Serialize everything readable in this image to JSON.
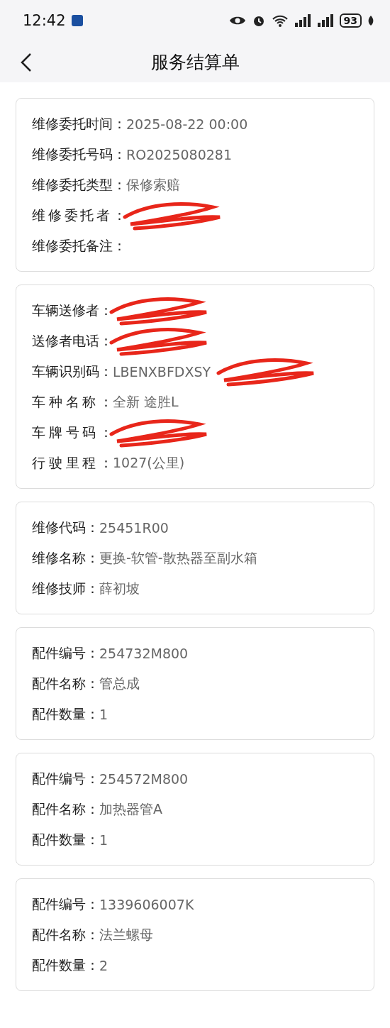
{
  "status_bar": {
    "time": "12:42",
    "battery": "93"
  },
  "header": {
    "title": "服务结算单"
  },
  "cards": [
    {
      "rows": [
        {
          "label": "维修委托时间：",
          "value": "2025-08-22 00:00"
        },
        {
          "label": "维修委托号码：",
          "value": "RO2025080281"
        },
        {
          "label": "维修委托类型：",
          "value": "保修索赔"
        },
        {
          "label": "维修委托者：",
          "redacted": true
        },
        {
          "label": "维修委托备注："
        }
      ]
    },
    {
      "rows": [
        {
          "label": "车辆送修者：",
          "redacted": true
        },
        {
          "label": "送修者电话：",
          "redacted": true
        },
        {
          "label": "车辆识别码：",
          "value": "LBENXBFDXSY",
          "redacted": true
        },
        {
          "label": "车种名称：",
          "value": "全新 途胜L"
        },
        {
          "label": "车牌号码：",
          "redacted": true
        },
        {
          "label": "行驶里程：",
          "value": "1027(公里)"
        }
      ]
    },
    {
      "rows": [
        {
          "label": "维修代码：",
          "value": "25451R00"
        },
        {
          "label": "维修名称：",
          "value": "更换-软管-散热器至副水箱"
        },
        {
          "label": "维修技师：",
          "value": "薛初坡"
        }
      ]
    },
    {
      "rows": [
        {
          "label": "配件编号：",
          "value": "254732M800"
        },
        {
          "label": "配件名称：",
          "value": "管总成"
        },
        {
          "label": "配件数量：",
          "value": "1"
        }
      ]
    },
    {
      "rows": [
        {
          "label": "配件编号：",
          "value": "254572M800"
        },
        {
          "label": "配件名称：",
          "value": "加热器管A"
        },
        {
          "label": "配件数量：",
          "value": "1"
        }
      ]
    },
    {
      "rows": [
        {
          "label": "配件编号：",
          "value": "1339606007K"
        },
        {
          "label": "配件名称：",
          "value": "法兰螺母"
        },
        {
          "label": "配件数量：",
          "value": "2"
        }
      ]
    }
  ]
}
